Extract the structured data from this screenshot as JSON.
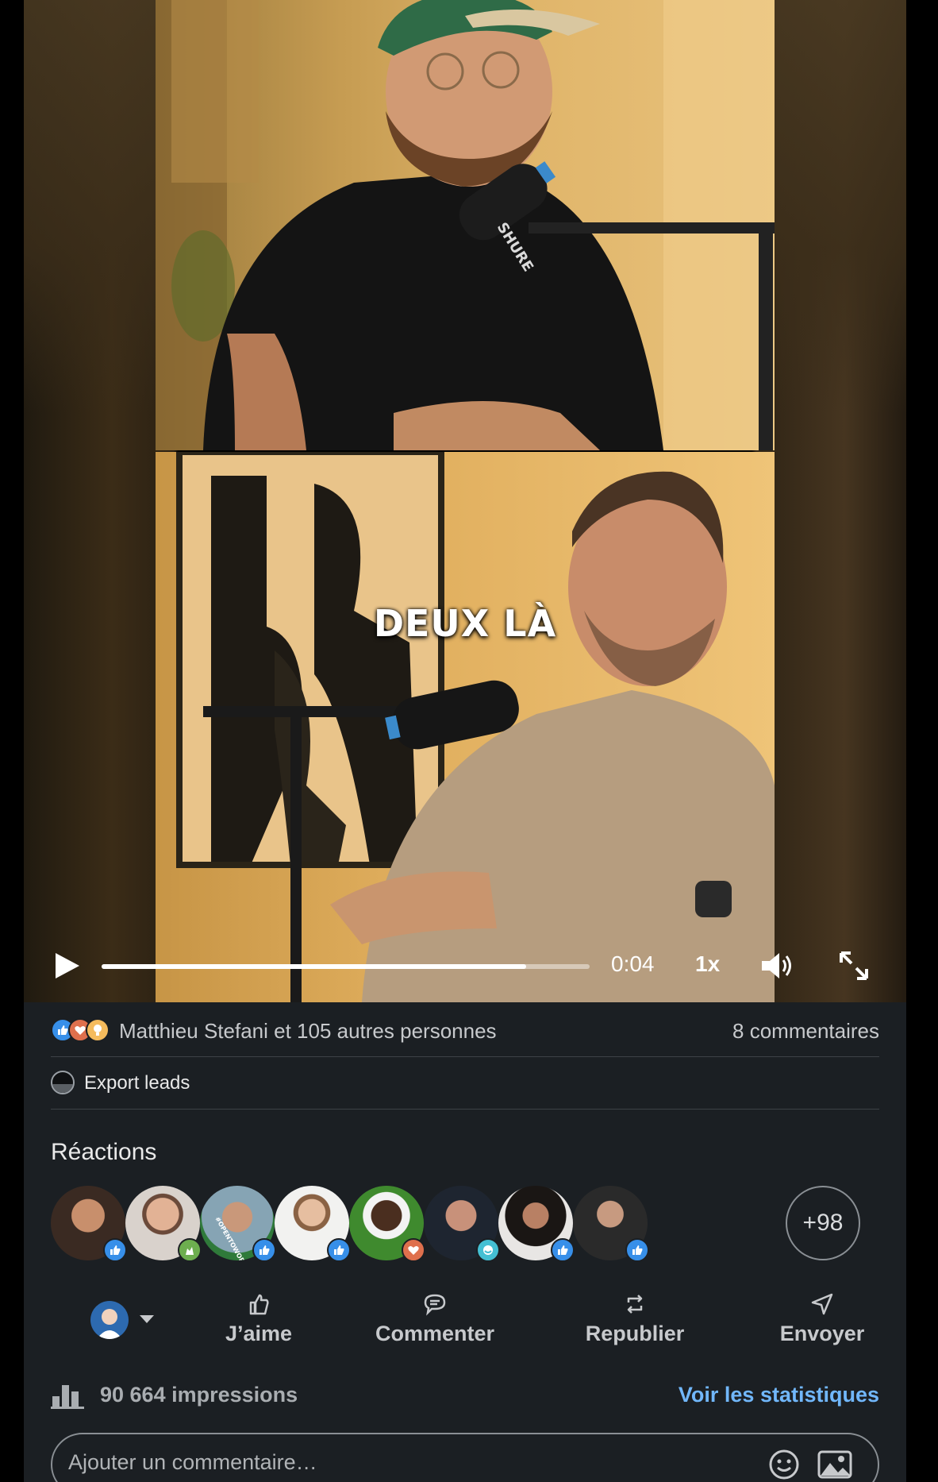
{
  "video": {
    "subtitle": "DEUX LÀ",
    "time": "0:04",
    "speed": "1x",
    "progress_fraction": 0.87,
    "mic_brand": "SHURE"
  },
  "social": {
    "reaction_icons": [
      "like",
      "love",
      "insightful"
    ],
    "summary": "Matthieu Stefani et 105 autres personnes",
    "comments": "8 commentaires"
  },
  "export": {
    "label": "Export leads"
  },
  "reactions": {
    "title": "Réactions",
    "avatars": [
      {
        "badge": "like"
      },
      {
        "badge": "celebrate"
      },
      {
        "badge": "like",
        "frame_text": "#OPENTOWORK"
      },
      {
        "badge": "like"
      },
      {
        "badge": "love"
      },
      {
        "badge": "funny"
      },
      {
        "badge": "like"
      },
      {
        "badge": "like"
      }
    ],
    "more": "+98"
  },
  "actions": {
    "like": "J’aime",
    "comment": "Commenter",
    "repost": "Republier",
    "send": "Envoyer"
  },
  "stats": {
    "impressions": "90 664 impressions",
    "link": "Voir les statistiques"
  },
  "comment_input": {
    "placeholder": "Ajouter un commentaire…"
  },
  "colors": {
    "card_bg": "#1b1f23",
    "link": "#71b7fb",
    "like": "#378fe9",
    "love": "#df704d",
    "celebrate": "#6dae4f",
    "insightful": "#f5bb5c",
    "funny": "#44bfd3"
  }
}
